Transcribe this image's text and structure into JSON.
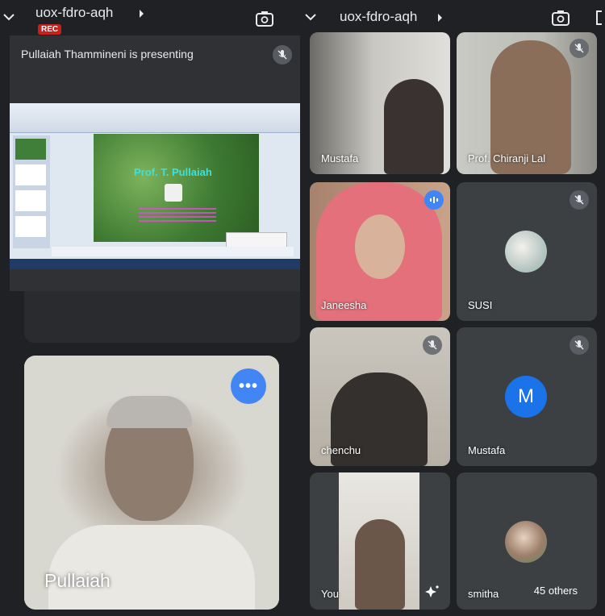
{
  "left_header": {
    "meeting_code": "uox-fdro-aqh",
    "rec_badge": "REC"
  },
  "right_header": {
    "meeting_code": "uox-fdro-aqh"
  },
  "presentation": {
    "presenting_label": "Pullaiah Thammineni is presenting",
    "slide_title": "Prof. T. Pullaiah"
  },
  "self_view": {
    "name": "Pullaiah"
  },
  "participants": [
    {
      "name": "Mustafa",
      "muted": false
    },
    {
      "name": "Prof. Chiranji Lal",
      "muted": true
    },
    {
      "name": "Janeesha",
      "speaking": true
    },
    {
      "name": "SUSI",
      "muted": true
    },
    {
      "name": "chenchu",
      "muted": true
    },
    {
      "name": "Mustafa",
      "muted": true,
      "avatar_letter": "M"
    },
    {
      "name": "You"
    },
    {
      "name": "smitha",
      "others_label": "45 others"
    }
  ],
  "colors": {
    "background": "#202124",
    "tile": "#3c4043",
    "accent": "#4285f4",
    "rec": "#c5221f",
    "avatar_m": "#1a73e8"
  }
}
